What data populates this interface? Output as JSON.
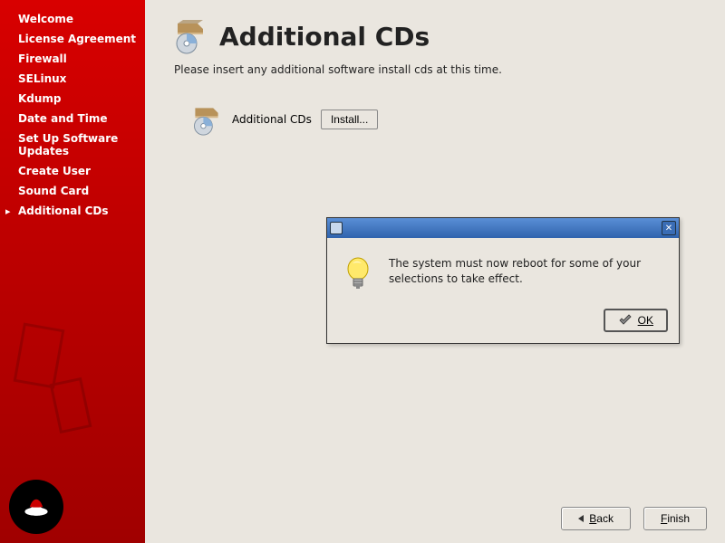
{
  "sidebar": {
    "items": [
      {
        "label": "Welcome",
        "active": false
      },
      {
        "label": "License Agreement",
        "active": false
      },
      {
        "label": "Firewall",
        "active": false
      },
      {
        "label": "SELinux",
        "active": false
      },
      {
        "label": "Kdump",
        "active": false
      },
      {
        "label": "Date and Time",
        "active": false
      },
      {
        "label": "Set Up Software Updates",
        "active": false
      },
      {
        "label": "Create User",
        "active": false
      },
      {
        "label": "Sound Card",
        "active": false
      },
      {
        "label": "Additional CDs",
        "active": true
      }
    ]
  },
  "main": {
    "title": "Additional CDs",
    "instruction": "Please insert any additional software install cds at this time.",
    "cd_label": "Additional CDs",
    "install_btn": "Install..."
  },
  "dialog": {
    "message": "The system must now reboot for some of your selections to take effect.",
    "ok_label": "OK"
  },
  "footer": {
    "back_first": "B",
    "back_rest": "ack",
    "finish_first": "F",
    "finish_rest": "inish"
  }
}
